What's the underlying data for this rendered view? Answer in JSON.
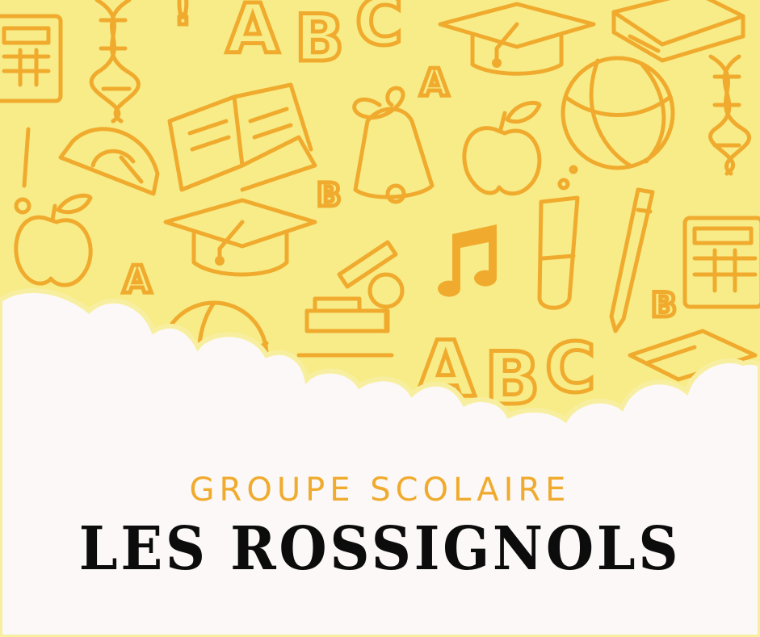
{
  "banner": {
    "subtitle": "GROUPE SCOLAIRE",
    "title": "LES ROSSIGNOLS"
  },
  "colors": {
    "background_yellow": "#f7ec87",
    "doodle_orange": "#f0ab2e",
    "cloud_white": "#fbf8f7",
    "title_black": "#0c0c0c"
  },
  "doodle_icons": [
    "calculator-icon",
    "dna-icon",
    "letters-abc-icon",
    "graduation-cap-icon",
    "book-icon",
    "apple-icon",
    "basketball-icon",
    "exclamation-icon",
    "protractor-icon",
    "bell-icon",
    "test-tube-icon",
    "pencil-icon",
    "music-note-icon",
    "microscope-icon",
    "globe-icon"
  ]
}
